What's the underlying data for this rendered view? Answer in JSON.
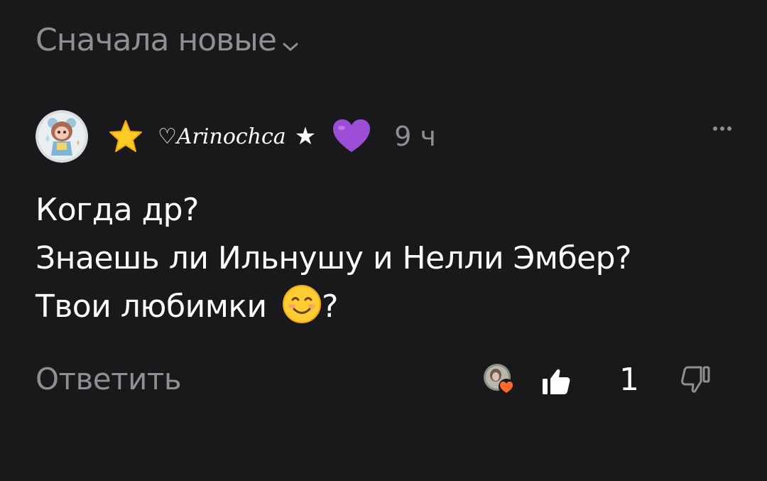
{
  "sort": {
    "label": "Сначала новые",
    "icon": "chevron-down-icon"
  },
  "comment": {
    "author": {
      "name": "♡Arinochca",
      "prefix_emoji": "star-emoji",
      "suffix_symbol": "★",
      "suffix_emoji": "purple-heart-emoji"
    },
    "time": "9 ч",
    "lines": [
      "Когда др?",
      "Знаешь ли Ильнушу и Нелли Эмбер?",
      "Твои любимки"
    ],
    "line3_suffix": "?",
    "more_icon": "more-horizontal-icon"
  },
  "footer": {
    "reply_label": "Ответить",
    "like_count": "1",
    "like_icon": "thumbs-up-icon",
    "dislike_icon": "thumbs-down-icon",
    "reaction_icon": "heart-reaction-icon"
  },
  "colors": {
    "background": "#19191b",
    "muted_text": "#8e8e93",
    "primary_text": "#ffffff",
    "accent_orange": "#ff6a2b"
  }
}
